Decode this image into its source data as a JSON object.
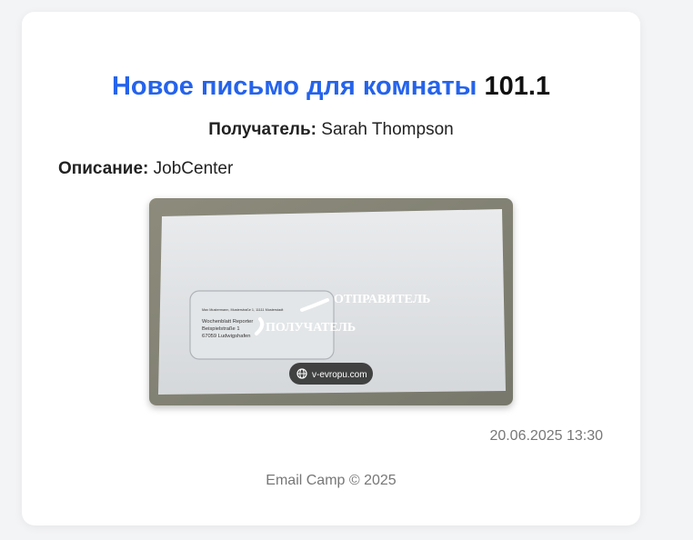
{
  "header": {
    "title_prefix": "Новое письмо для комнаты",
    "room_number": "101.1"
  },
  "letter": {
    "recipient_label": "Получатель:",
    "recipient_name": "Sarah Thompson",
    "description_label": "Описание:",
    "description_value": "JobCenter",
    "timestamp": "20.06.2025 13:30"
  },
  "photo": {
    "sender_address_line": "Max Mustermann, Musterstraße 1, 11111 Musterstadt",
    "recipient_lines": [
      "Wochenblatt Reporter",
      "Beispielstraße 1",
      "67059 Ludwigshafen"
    ],
    "sender_caption": "ОТПРАВИТЕЛЬ",
    "recipient_caption": "ПОЛУЧАТЕЛЬ",
    "watermark": "v-evropu.com"
  },
  "footer": {
    "text": "Email Camp © 2025"
  },
  "colors": {
    "accent": "#2563eb",
    "muted_text": "#777777"
  }
}
